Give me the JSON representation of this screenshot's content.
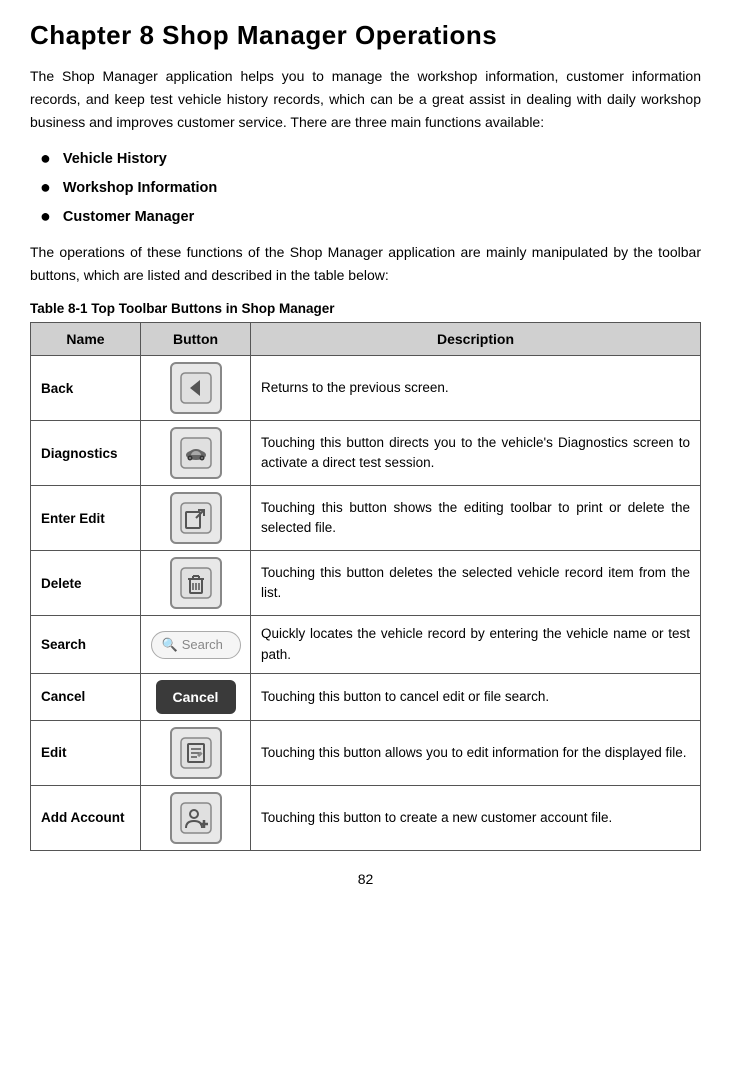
{
  "title": "Chapter 8   Shop Manager Operations",
  "intro": "The Shop Manager application helps you to manage the workshop information, customer information records, and keep test vehicle history records, which can be a great assist in dealing with daily workshop business and improves customer service. There are three main functions available:",
  "bullets": [
    "Vehicle History",
    "Workshop Information",
    "Customer Manager"
  ],
  "operations_text": "The operations of these functions of the Shop Manager application are mainly manipulated by the toolbar buttons, which are listed and described in the table below:",
  "table_caption_bold": "Table 8-1",
  "table_caption_italic": " Top Toolbar Buttons in Shop Manager",
  "table_headers": [
    "Name",
    "Button",
    "Description"
  ],
  "table_rows": [
    {
      "name": "Back",
      "button_type": "back",
      "description": "Returns to the previous screen."
    },
    {
      "name": "Diagnostics",
      "button_type": "diagnostics",
      "description": "Touching this button directs you to the vehicle's Diagnostics screen to activate a direct test session."
    },
    {
      "name": "Enter Edit",
      "button_type": "enter-edit",
      "description": "Touching this button shows the editing toolbar to print or delete the selected file."
    },
    {
      "name": "Delete",
      "button_type": "delete",
      "description": "Touching this button deletes the selected vehicle record item from the list."
    },
    {
      "name": "Search",
      "button_type": "search",
      "description": "Quickly locates the vehicle record by entering the vehicle name or test path."
    },
    {
      "name": "Cancel",
      "button_type": "cancel",
      "description": "Touching this button to cancel edit or file search."
    },
    {
      "name": "Edit",
      "button_type": "edit",
      "description": "Touching this button allows you to edit information for the displayed file."
    },
    {
      "name": "Add Account",
      "button_type": "add-account",
      "description": "Touching this button to create a new customer account file."
    }
  ],
  "page_number": "82",
  "search_placeholder": "Search",
  "cancel_label": "Cancel"
}
